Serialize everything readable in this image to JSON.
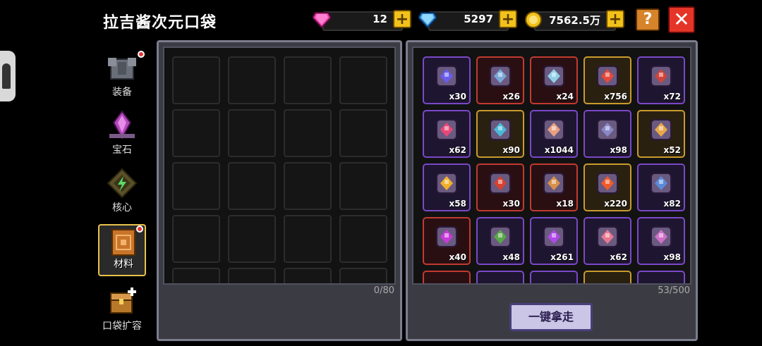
{
  "title": "拉吉酱次元口袋",
  "currencies": [
    {
      "icon": "pink-gem-icon",
      "value": "12",
      "color": "#e63ea8"
    },
    {
      "icon": "blue-diamond-icon",
      "value": "5297",
      "color": "#3ea8f0"
    },
    {
      "icon": "gold-coin-icon",
      "value": "7562.5万",
      "color": "#f2c21a"
    }
  ],
  "header": {
    "help_label": "?",
    "close_label": "✕",
    "plus_label": "+"
  },
  "tabs": [
    {
      "label": "装备",
      "icon": "armor-icon",
      "badge": true,
      "active": false
    },
    {
      "label": "宝石",
      "icon": "gem-crystal-icon",
      "badge": false,
      "active": false
    },
    {
      "label": "核心",
      "icon": "core-icon",
      "badge": false,
      "active": false
    },
    {
      "label": "材料",
      "icon": "material-book-icon",
      "badge": true,
      "active": true
    },
    {
      "label": "口袋扩容",
      "icon": "chest-expand-icon",
      "badge": false,
      "active": false
    }
  ],
  "left_panel": {
    "count": "0/80"
  },
  "right_panel": {
    "count": "53/500",
    "take_all_label": "一键拿走"
  },
  "items": [
    {
      "qty": "x30",
      "rarity": "purple",
      "icon": "blaster-icon",
      "color": "#6a5cf0"
    },
    {
      "qty": "x26",
      "rarity": "red",
      "icon": "axe-icon",
      "color": "#7aa8d8"
    },
    {
      "qty": "x24",
      "rarity": "red",
      "icon": "hammer-icon",
      "color": "#8fd0e8"
    },
    {
      "qty": "x756",
      "rarity": "gold",
      "icon": "red-crystal-icon",
      "color": "#e8483a"
    },
    {
      "qty": "x72",
      "rarity": "purple",
      "icon": "horseshoe-icon",
      "color": "#d0443a"
    },
    {
      "qty": "x62",
      "rarity": "purple",
      "icon": "heart-icon",
      "color": "#e84878"
    },
    {
      "qty": "x90",
      "rarity": "gold",
      "icon": "creature-icon",
      "color": "#4ab8d8"
    },
    {
      "qty": "x1044",
      "rarity": "purple",
      "icon": "scroll-icon",
      "color": "#e8a080"
    },
    {
      "qty": "x98",
      "rarity": "purple",
      "icon": "chip-icon",
      "color": "#8888c8"
    },
    {
      "qty": "x52",
      "rarity": "gold",
      "icon": "pickaxe-icon",
      "color": "#e8a848"
    },
    {
      "qty": "x58",
      "rarity": "purple",
      "icon": "ankh-icon",
      "color": "#f2b02a"
    },
    {
      "qty": "x30",
      "rarity": "red",
      "icon": "flower-icon",
      "color": "#d84030"
    },
    {
      "qty": "x18",
      "rarity": "red",
      "icon": "meat-icon",
      "color": "#d8904a"
    },
    {
      "qty": "x220",
      "rarity": "gold",
      "icon": "sun-gear-icon",
      "color": "#f25a2a"
    },
    {
      "qty": "x82",
      "rarity": "purple",
      "icon": "blade-icon",
      "color": "#5a8ad8"
    },
    {
      "qty": "x40",
      "rarity": "red",
      "icon": "orb-icon",
      "color": "#c83ad8"
    },
    {
      "qty": "x48",
      "rarity": "purple",
      "icon": "plant-icon",
      "color": "#58a848"
    },
    {
      "qty": "x261",
      "rarity": "purple",
      "icon": "potion-icon",
      "color": "#b048e8"
    },
    {
      "qty": "x62",
      "rarity": "purple",
      "icon": "pink-stone-icon",
      "color": "#e87890"
    },
    {
      "qty": "x98",
      "rarity": "purple",
      "icon": "wand-icon",
      "color": "#d070c8"
    },
    {
      "qty": "",
      "rarity": "red",
      "icon": "",
      "color": "#c23a30"
    },
    {
      "qty": "",
      "rarity": "purple",
      "icon": "",
      "color": "#7a48c8"
    },
    {
      "qty": "",
      "rarity": "purple",
      "icon": "",
      "color": "#7a48c8"
    },
    {
      "qty": "",
      "rarity": "gold",
      "icon": "",
      "color": "#c99b2e"
    },
    {
      "qty": "",
      "rarity": "purple",
      "icon": "",
      "color": "#7a48c8"
    }
  ]
}
